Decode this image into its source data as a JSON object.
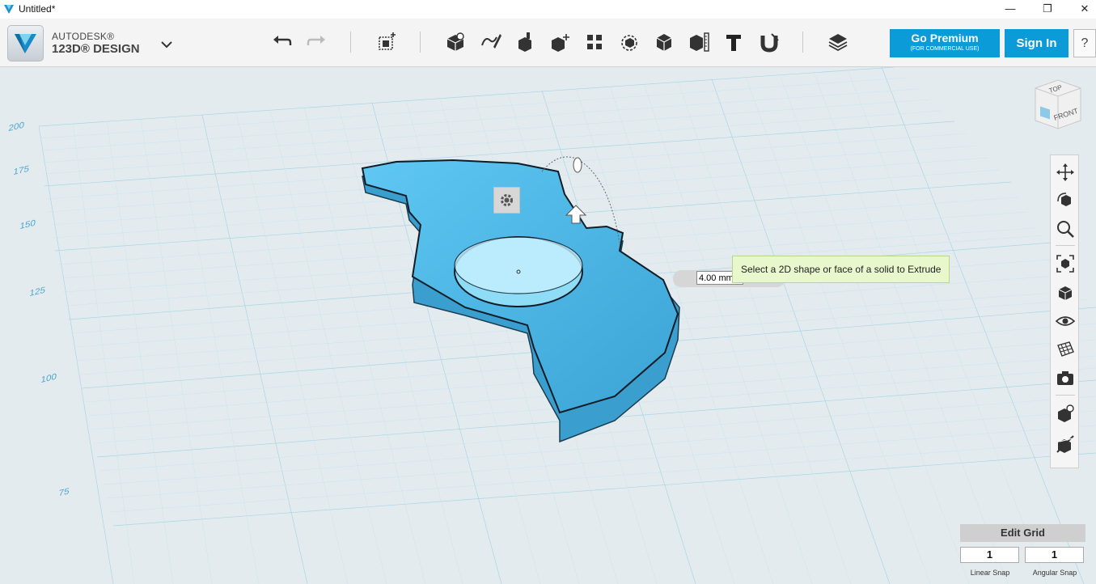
{
  "window": {
    "title": "Untitled*",
    "minimize": "—",
    "maximize": "❐",
    "close": "✕"
  },
  "brand": {
    "line1": "AUTODESK®",
    "line2": "123D® DESIGN"
  },
  "toolbar": {
    "tools": [
      "undo-icon",
      "redo-icon",
      "primitives-icon",
      "sketch-icon",
      "construct-icon",
      "modify-icon",
      "pattern-icon",
      "grouping-icon",
      "combine-icon",
      "measure-icon",
      "text-icon",
      "snap-icon",
      "material-icon"
    ]
  },
  "account": {
    "premium_label": "Go Premium",
    "premium_sub": "(FOR COMMERCIAL USE)",
    "signin_label": "Sign In",
    "help_label": "?"
  },
  "viewport": {
    "axis_labels": [
      "200",
      "175",
      "150",
      "125",
      "100",
      "75"
    ],
    "tooltip": "Select a 2D shape or face of a solid to Extrude",
    "extrude_value": "4.00 mm"
  },
  "viewcube": {
    "top": "TOP",
    "front": "FRONT"
  },
  "navbar": {
    "items": [
      "pan-icon",
      "orbit-icon",
      "zoom-icon",
      "fit-icon",
      "view-mode-icon",
      "visibility-icon",
      "grid-icon",
      "camera-icon",
      "material-view-icon",
      "hide-icon"
    ]
  },
  "grid": {
    "edit_label": "Edit Grid",
    "linear_snap_value": "1",
    "angular_snap_value": "1",
    "linear_snap_label": "Linear Snap",
    "angular_snap_label": "Angular Snap"
  },
  "colors": {
    "accent": "#0b9bd8",
    "grid": "#9ccfe3",
    "solid": "#4bb6e3",
    "tooltip_bg": "#e8f7cc"
  }
}
